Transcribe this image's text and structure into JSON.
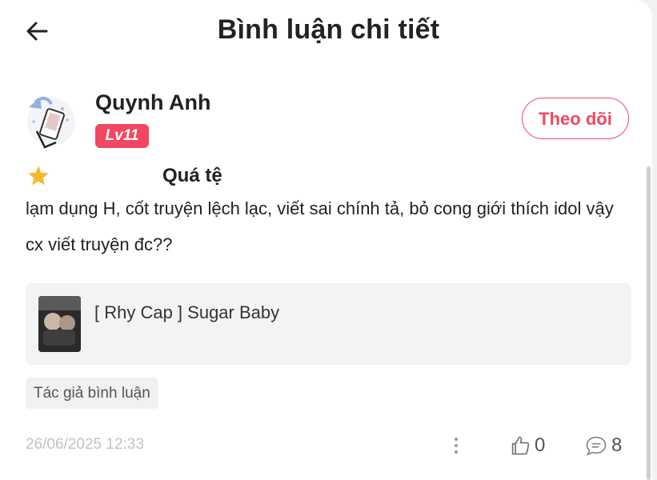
{
  "header": {
    "title": "Bình luận chi tiết",
    "back_icon": "arrow-left-icon"
  },
  "user": {
    "name": "Quynh Anh",
    "level": "Lv11",
    "follow_label": "Theo dõi"
  },
  "review": {
    "rating_icon": "star-icon",
    "rating_stars": 1,
    "title": "Quá tệ",
    "body": "lạm dụng H, cốt truyện lệch lạc, viết sai chính tả, bỏ cong giới thích idol vậy cx viết truyện đc??"
  },
  "book": {
    "title": "[ Rhy Cap ] Sugar Baby"
  },
  "tag": "Tác giả bình luận",
  "meta": {
    "timestamp": "26/06/2025 12:33",
    "likes": "0",
    "comments": "8"
  },
  "colors": {
    "accent": "#f2475f",
    "star": "#f5b82e",
    "muted": "#c2c2c2"
  }
}
